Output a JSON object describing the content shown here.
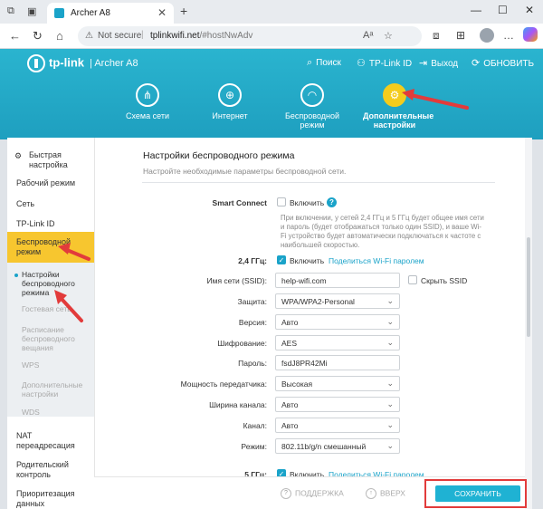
{
  "browser": {
    "tab_title": "Archer A8",
    "close_tab": "✕",
    "new_tab": "+",
    "not_secure": "Not secure",
    "url_host": "tplinkwifi.net",
    "url_path": "/#hostNwAdv"
  },
  "header": {
    "brand": "tp-link",
    "model": "Archer A8",
    "links": {
      "search": "Поиск",
      "tplink_id": "TP-Link ID",
      "logout": "Выход",
      "update": "ОБНОВИТЬ"
    },
    "nav": [
      {
        "label": "Схема сети",
        "icon": "network-map-icon"
      },
      {
        "label": "Интернет",
        "icon": "globe-icon"
      },
      {
        "label": "Беспроводной режим",
        "icon": "wifi-icon"
      },
      {
        "label": "Дополнительные настройки",
        "icon": "gear-icon"
      }
    ]
  },
  "sidebar": {
    "quick_setup": "Быстрая настройка",
    "mode": "Рабочий режим",
    "network": "Сеть",
    "tplink_id": "TP-Link ID",
    "wireless": "Беспроводной режим",
    "wireless_settings": "Настройки беспроводного режима",
    "guest": "Гостевая сеть",
    "schedule": "Расписание беспроводного вещания",
    "wps": "WPS",
    "additional": "Дополнительные настройки",
    "wds": "WDS",
    "nat": "NAT переадресация",
    "parental": "Родительский контроль",
    "priority": "Приоритезация данных"
  },
  "content": {
    "title": "Настройки беспроводного режима",
    "description": "Настройте необходимые параметры беспроводной сети.",
    "smart_connect_label": "Smart Connect",
    "enable": "Включить",
    "smart_connect_note": "При включении, у сетей 2,4 ГГц и 5 ГГц будет общее имя сети и пароль (будет отображаться только один SSID), и ваше Wi-Fi устройство будет автоматически подключаться к частоте с наибольшей скоростью.",
    "band24": "2,4 ГГц:",
    "share_password": "Поделиться Wi-Fi паролем",
    "ssid_label": "Имя сети (SSID):",
    "ssid_value": "help-wifi.com",
    "hide_ssid": "Скрыть SSID",
    "security_label": "Защита:",
    "security_value": "WPA/WPA2-Personal",
    "version_label": "Версия:",
    "version_value": "Авто",
    "encryption_label": "Шифрование:",
    "encryption_value": "AES",
    "password_label": "Пароль:",
    "password_value": "fsdJ8PR42Mi",
    "power_label": "Мощность передатчика:",
    "power_value": "Высокая",
    "width_label": "Ширина канала:",
    "width_value": "Авто",
    "channel_label": "Канал:",
    "channel_value": "Авто",
    "mode_label": "Режим:",
    "mode_value": "802.11b/g/n смешанный",
    "band5": "5 ГГц:"
  },
  "footer": {
    "support": "ПОДДЕРЖКА",
    "top": "ВВЕРХ",
    "save": "СОХРАНИТЬ"
  },
  "colors": {
    "brand": "#1fb2d3",
    "active": "#f7c62f",
    "highlight": "#e23b3b"
  }
}
